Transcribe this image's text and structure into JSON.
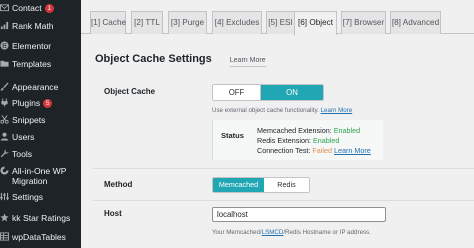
{
  "sidebar": {
    "items": [
      {
        "label": "Contact",
        "badge": "1",
        "icon": "envelope-icon"
      },
      {
        "label": "Rank Math",
        "badge": "",
        "icon": "rank-math-icon"
      },
      {
        "label": "Elementor",
        "badge": "",
        "icon": "elementor-icon"
      },
      {
        "label": "Templates",
        "badge": "",
        "icon": "folder-icon"
      },
      {
        "label": "Appearance",
        "badge": "",
        "icon": "paintbrush-icon"
      },
      {
        "label": "Plugins",
        "badge": "5",
        "icon": "plug-icon"
      },
      {
        "label": "Snippets",
        "badge": "",
        "icon": "scissors-icon"
      },
      {
        "label": "Users",
        "badge": "",
        "icon": "user-icon"
      },
      {
        "label": "Tools",
        "badge": "",
        "icon": "wrench-icon"
      },
      {
        "label": "All-in-One WP",
        "label2": "Migration",
        "badge": "",
        "icon": "migration-icon"
      },
      {
        "label": "Settings",
        "badge": "",
        "icon": "settings-icon"
      },
      {
        "label": "kk Star Ratings",
        "badge": "",
        "icon": "star-icon"
      },
      {
        "label": "wpDataTables",
        "badge": "",
        "icon": "table-icon"
      }
    ]
  },
  "tabs": [
    {
      "label": "[1] Cache"
    },
    {
      "label": "[2] TTL"
    },
    {
      "label": "[3] Purge"
    },
    {
      "label": "[4] Excludes"
    },
    {
      "label": "[5] ESI"
    },
    {
      "label": "[6] Object",
      "active": true
    },
    {
      "label": "[7] Browser"
    },
    {
      "label": "[8] Advanced"
    }
  ],
  "section": {
    "title": "Object Cache Settings",
    "learn_more": "Learn More"
  },
  "object_cache": {
    "label": "Object Cache",
    "off_label": "OFF",
    "on_label": "ON",
    "selected": "ON",
    "description": "Use external object cache functionality.",
    "learn_more": "Learn More"
  },
  "status": {
    "label": "Status",
    "memcached_prefix": "Memcached Extension:",
    "memcached_value": "Enabled",
    "redis_prefix": "Redis Extension:",
    "redis_value": "Enabled",
    "connection_prefix": "Connection Test:",
    "connection_value": "Failed",
    "learn_more": "Learn More"
  },
  "method": {
    "label": "Method",
    "options": [
      "Memcached",
      "Redis"
    ],
    "selected": "Memcached"
  },
  "host": {
    "label": "Host",
    "value": "localhost",
    "desc_prefix": "Your Memcached/",
    "desc_link": "LSMCD",
    "desc_suffix": "/Redis Hostname or IP address."
  },
  "colors": {
    "sidebar_bg": "#1d2327",
    "accent": "#21a7b4",
    "enabled": "#2ea44f",
    "failed": "#e2904f",
    "badge": "#d63638",
    "link": "#2271b1"
  }
}
